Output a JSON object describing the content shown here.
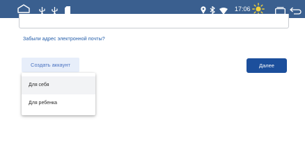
{
  "statusbar": {
    "time": "17:06",
    "icons": [
      "home-icon",
      "usb-icon",
      "usb-icon",
      "sd-card-icon",
      "location-icon",
      "bluetooth-icon",
      "wifi-icon",
      "brightness-icon",
      "recent-apps-icon",
      "back-icon"
    ],
    "background": "#3a5f8f"
  },
  "form": {
    "forgot_email_link": "Забыли адрес электронной почты?",
    "create_account_button": "Создать аккаунт",
    "next_button": "Далее"
  },
  "account_menu": {
    "items": [
      {
        "label": "Для себя"
      },
      {
        "label": "Для ребенка"
      }
    ]
  },
  "colors": {
    "link": "#1f5aa8",
    "primary_button": "#1c4f9c",
    "secondary_button_bg": "#e7eefa"
  }
}
